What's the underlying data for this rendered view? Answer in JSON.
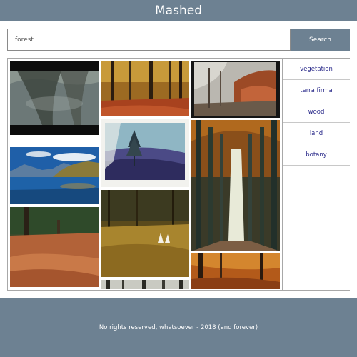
{
  "app": {
    "title": "Mashed"
  },
  "search": {
    "value": "forest",
    "button_label": "Search"
  },
  "sidebar": {
    "items": [
      {
        "label": "vegetation"
      },
      {
        "label": "terra firma"
      },
      {
        "label": "wood"
      },
      {
        "label": "land"
      },
      {
        "label": "botany"
      }
    ]
  },
  "gallery": {
    "photos": [
      {
        "name": "forest-reflection-photo"
      },
      {
        "name": "lake-mountains-photo"
      },
      {
        "name": "autumn-grass-meadow-photo"
      },
      {
        "name": "autumn-forest-photo"
      },
      {
        "name": "polaroid-lone-tree-photo"
      },
      {
        "name": "golden-forest-clearing-photo"
      },
      {
        "name": "birch-strip-photo"
      },
      {
        "name": "misty-autumn-trees-photo"
      },
      {
        "name": "autumn-tree-avenue-photo"
      },
      {
        "name": "orange-woodland-photo"
      }
    ]
  },
  "footer": {
    "text": "No rights reserved, whatsoever - 2018 (and forever)"
  }
}
